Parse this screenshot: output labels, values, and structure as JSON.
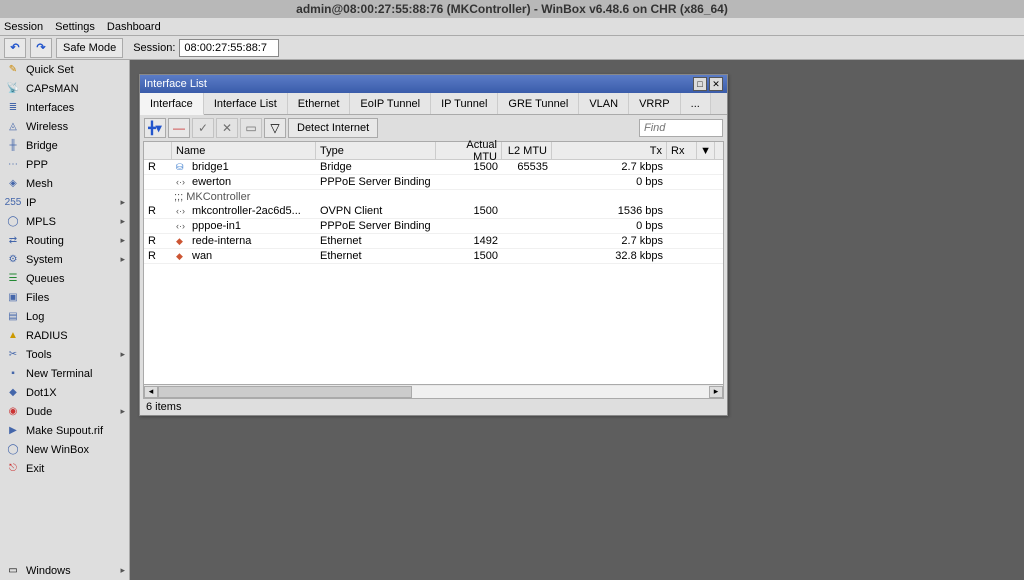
{
  "title": "admin@08:00:27:55:88:76 (MKController) - WinBox v6.48.6 on CHR (x86_64)",
  "menu": {
    "session": "Session",
    "settings": "Settings",
    "dashboard": "Dashboard"
  },
  "toolbar": {
    "undo": "↶",
    "redo": "↷",
    "safe_mode": "Safe Mode",
    "session_label": "Session:",
    "session_value": "08:00:27:55:88:7"
  },
  "sidebar": {
    "items": [
      {
        "label": "Quick Set",
        "arrow": false
      },
      {
        "label": "CAPsMAN",
        "arrow": false
      },
      {
        "label": "Interfaces",
        "arrow": false
      },
      {
        "label": "Wireless",
        "arrow": false
      },
      {
        "label": "Bridge",
        "arrow": false
      },
      {
        "label": "PPP",
        "arrow": false
      },
      {
        "label": "Mesh",
        "arrow": false
      },
      {
        "label": "IP",
        "arrow": true
      },
      {
        "label": "MPLS",
        "arrow": true
      },
      {
        "label": "Routing",
        "arrow": true
      },
      {
        "label": "System",
        "arrow": true
      },
      {
        "label": "Queues",
        "arrow": false
      },
      {
        "label": "Files",
        "arrow": false
      },
      {
        "label": "Log",
        "arrow": false
      },
      {
        "label": "RADIUS",
        "arrow": false
      },
      {
        "label": "Tools",
        "arrow": true
      },
      {
        "label": "New Terminal",
        "arrow": false
      },
      {
        "label": "Dot1X",
        "arrow": false
      },
      {
        "label": "Dude",
        "arrow": true
      },
      {
        "label": "Make Supout.rif",
        "arrow": false
      },
      {
        "label": "New WinBox",
        "arrow": false
      },
      {
        "label": "Exit",
        "arrow": false
      }
    ],
    "bottom": {
      "label": "Windows",
      "arrow": true
    }
  },
  "window": {
    "title": "Interface List",
    "tabs": [
      "Interface",
      "Interface List",
      "Ethernet",
      "EoIP Tunnel",
      "IP Tunnel",
      "GRE Tunnel",
      "VLAN",
      "VRRP",
      "..."
    ],
    "detect": "Detect Internet",
    "find_placeholder": "Find",
    "columns": {
      "name": "Name",
      "type": "Type",
      "mtu": "Actual MTU",
      "l2": "L2 MTU",
      "tx": "Tx",
      "rx": "Rx"
    },
    "rows": [
      {
        "flag": "R",
        "name": "bridge1",
        "type": "Bridge",
        "mtu": "1500",
        "l2": "65535",
        "tx": "2.7 kbps"
      },
      {
        "flag": "",
        "name": "ewerton",
        "type": "PPPoE Server Binding",
        "mtu": "",
        "l2": "",
        "tx": "0 bps"
      }
    ],
    "comment": ";;; MKController",
    "rows2": [
      {
        "flag": "R",
        "name": "mkcontroller-2ac6d5...",
        "type": "OVPN Client",
        "mtu": "1500",
        "l2": "",
        "tx": "1536 bps"
      },
      {
        "flag": "",
        "name": "pppoe-in1",
        "type": "PPPoE Server Binding",
        "mtu": "",
        "l2": "",
        "tx": "0 bps"
      },
      {
        "flag": "R",
        "name": "rede-interna",
        "type": "Ethernet",
        "mtu": "1492",
        "l2": "",
        "tx": "2.7 kbps"
      },
      {
        "flag": "R",
        "name": "wan",
        "type": "Ethernet",
        "mtu": "1500",
        "l2": "",
        "tx": "32.8 kbps"
      }
    ],
    "status": "6 items"
  }
}
